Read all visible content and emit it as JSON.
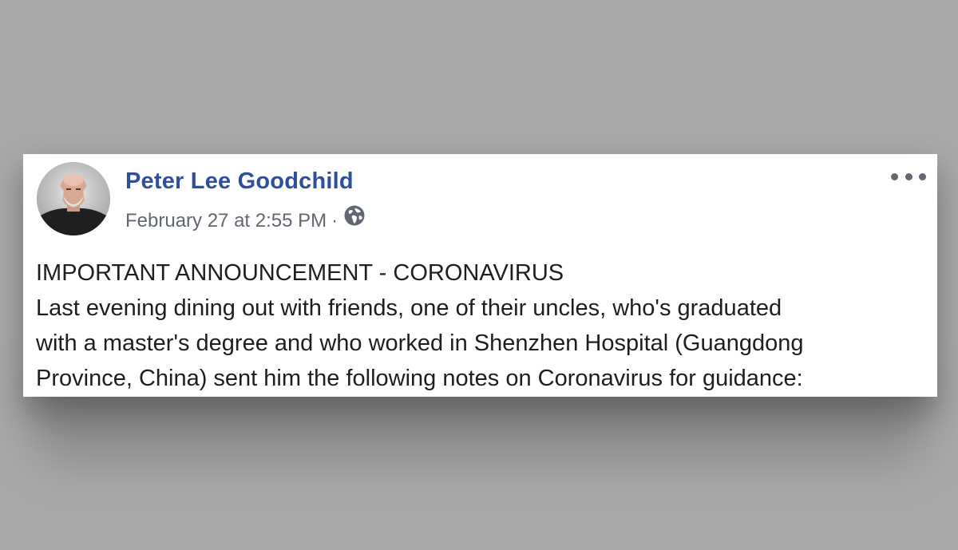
{
  "post": {
    "author_name": "Peter Lee Goodchild",
    "timestamp": "February 27 at 2:55 PM",
    "separator": "·",
    "privacy_icon": "globe-icon",
    "options_icon": "more-options-icon",
    "body_lines": [
      "IMPORTANT ANNOUNCEMENT - CORONAVIRUS",
      "Last evening dining out with friends, one of their uncles, who's graduated",
      "with a master's degree and who worked in Shenzhen Hospital (Guangdong",
      "Province, China) sent him the following notes on Coronavirus for guidance:"
    ]
  },
  "colors": {
    "background": "#aaaaaa",
    "card": "#ffffff",
    "author_link": "#2f4f9a",
    "meta_text": "#616770",
    "body_text": "#1c1e21"
  }
}
